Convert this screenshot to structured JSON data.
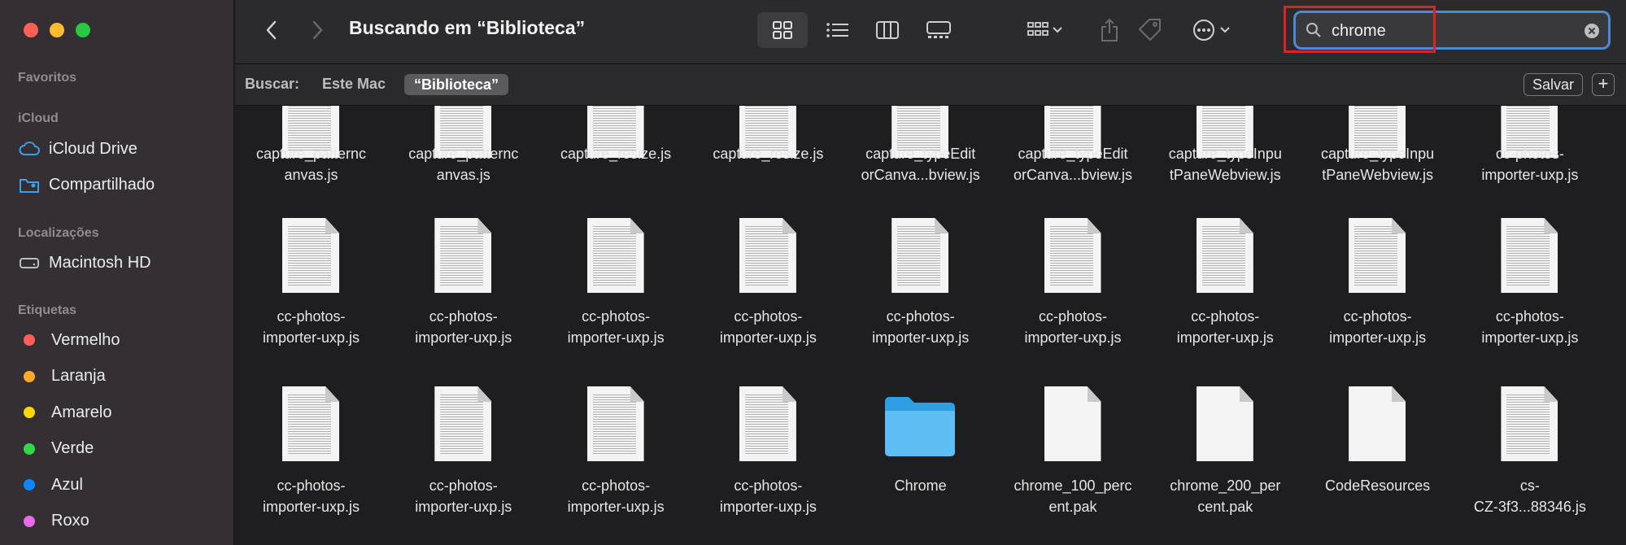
{
  "sidebar": {
    "sections": {
      "favorites": "Favoritos",
      "icloud": "iCloud",
      "locations": "Localizações",
      "tags": "Etiquetas"
    },
    "icloud_items": [
      {
        "label": "iCloud Drive",
        "icon": "cloud-icon"
      },
      {
        "label": "Compartilhado",
        "icon": "shared-folder-icon"
      }
    ],
    "location_items": [
      {
        "label": "Macintosh HD",
        "icon": "hard-drive-icon"
      }
    ],
    "tags": [
      {
        "label": "Vermelho",
        "color": "#ff5f57"
      },
      {
        "label": "Laranja",
        "color": "#ffa92b"
      },
      {
        "label": "Amarelo",
        "color": "#ffd60a"
      },
      {
        "label": "Verde",
        "color": "#32d74b"
      },
      {
        "label": "Azul",
        "color": "#0a84ff"
      },
      {
        "label": "Roxo",
        "color": "#e96aea"
      }
    ]
  },
  "toolbar": {
    "title": "Buscando em “Biblioteca”",
    "search_value": "chrome"
  },
  "scope": {
    "label": "Buscar:",
    "option_mac": "Este Mac",
    "option_selected": "“Biblioteca”",
    "save_label": "Salvar",
    "add_label": "+"
  },
  "files": [
    {
      "name": "capture_patternc\nanvas.js",
      "kind": "doc"
    },
    {
      "name": "capture_patternc\nanvas.js",
      "kind": "doc"
    },
    {
      "name": "capture_resize.js",
      "kind": "doc"
    },
    {
      "name": "capture_resize.js",
      "kind": "doc"
    },
    {
      "name": "capture_typeEdit\norCanva...bview.js",
      "kind": "doc"
    },
    {
      "name": "capture_typeEdit\norCanva...bview.js",
      "kind": "doc"
    },
    {
      "name": "capture_typeInpu\ntPaneWebview.js",
      "kind": "doc"
    },
    {
      "name": "capture_typeInpu\ntPaneWebview.js",
      "kind": "doc"
    },
    {
      "name": "cc-photos-\nimporter-uxp.js",
      "kind": "doc"
    },
    {
      "name": "cc-photos-\nimporter-uxp.js",
      "kind": "doc"
    },
    {
      "name": "cc-photos-\nimporter-uxp.js",
      "kind": "doc"
    },
    {
      "name": "cc-photos-\nimporter-uxp.js",
      "kind": "doc"
    },
    {
      "name": "cc-photos-\nimporter-uxp.js",
      "kind": "doc"
    },
    {
      "name": "cc-photos-\nimporter-uxp.js",
      "kind": "doc"
    },
    {
      "name": "cc-photos-\nimporter-uxp.js",
      "kind": "doc"
    },
    {
      "name": "cc-photos-\nimporter-uxp.js",
      "kind": "doc"
    },
    {
      "name": "cc-photos-\nimporter-uxp.js",
      "kind": "doc"
    },
    {
      "name": "cc-photos-\nimporter-uxp.js",
      "kind": "doc"
    },
    {
      "name": "cc-photos-\nimporter-uxp.js",
      "kind": "doc"
    },
    {
      "name": "cc-photos-\nimporter-uxp.js",
      "kind": "doc"
    },
    {
      "name": "cc-photos-\nimporter-uxp.js",
      "kind": "doc"
    },
    {
      "name": "cc-photos-\nimporter-uxp.js",
      "kind": "doc"
    },
    {
      "name": "Chrome",
      "kind": "folder"
    },
    {
      "name": "chrome_100_perc\nent.pak",
      "kind": "blank"
    },
    {
      "name": "chrome_200_per\ncent.pak",
      "kind": "blank"
    },
    {
      "name": "CodeResources",
      "kind": "blank"
    },
    {
      "name": "cs-\nCZ-3f3...88346.js",
      "kind": "doc"
    }
  ]
}
